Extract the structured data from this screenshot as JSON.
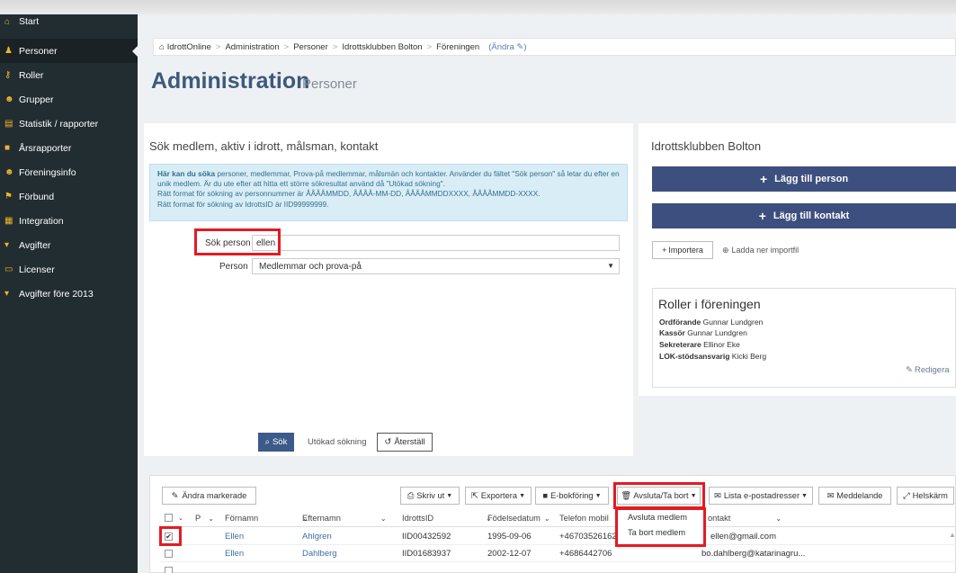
{
  "sidebar": {
    "items": [
      {
        "label": "Start",
        "icon": "home-icon",
        "glyph": "⌂"
      },
      {
        "label": "Personer",
        "icon": "person-icon",
        "glyph": "♟"
      },
      {
        "label": "Roller",
        "icon": "key-icon",
        "glyph": "⚷"
      },
      {
        "label": "Grupper",
        "icon": "group-icon",
        "glyph": "☻"
      },
      {
        "label": "Statistik / rapporter",
        "icon": "chart-icon",
        "glyph": "▤"
      },
      {
        "label": "Årsrapporter",
        "icon": "book-icon",
        "glyph": "■"
      },
      {
        "label": "Föreningsinfo",
        "icon": "group-icon",
        "glyph": "☻"
      },
      {
        "label": "Förbund",
        "icon": "flag-icon",
        "glyph": "⚑"
      },
      {
        "label": "Integration",
        "icon": "table-icon",
        "glyph": "▦"
      },
      {
        "label": "Avgifter",
        "icon": "cart-icon",
        "glyph": "▾"
      },
      {
        "label": "Licenser",
        "icon": "card-icon",
        "glyph": "▭"
      },
      {
        "label": "Avgifter före 2013",
        "icon": "cart-icon",
        "glyph": "▾"
      }
    ]
  },
  "breadcrumb": {
    "items": [
      "IdrottOnline",
      "Administration",
      "Personer",
      "Idrottsklubben Bolton",
      "Föreningen"
    ],
    "edit_label": "(Ändra ✎)"
  },
  "header": {
    "title": "Administration",
    "subtitle": "Personer"
  },
  "search": {
    "title": "Sök medlem, aktiv i idrott, målsman, kontakt",
    "info_bold": "Här kan du söka",
    "info_text": " personer, medlemmar, Prova-på medlemmar, målsmän och kontakter. Använder du fältet \"Sök person\" så letar du efter en unik medlem. Är du ute efter att hitta ett större sökresultat använd då \"Utökad sökning\".",
    "info_line2": "Rätt format för sökning av personnummer är ÅÅÅÅMMDD, ÅÅÅÅ-MM-DD, ÅÅÅÅMMDDXXXX, ÅÅÅÅMMDD-XXXX.",
    "info_line3": "Rätt format för sökning av IdrottsID är IID99999999.",
    "sok_label": "Sök person",
    "sok_value": "ellen",
    "person_label": "Person",
    "person_value": "Medlemmar och prova-på",
    "search_button": "Sök",
    "extended_link": "Utökad sökning",
    "reset_button": "Återställ"
  },
  "club": {
    "title": "Idrottsklubben Bolton",
    "add_person": "Lägg till person",
    "add_contact": "Lägg till kontakt",
    "import": "Importera",
    "download": "Ladda ner importfil",
    "roles_title": "Roller i föreningen",
    "roles": [
      {
        "role": "Ordförande",
        "name": "Gunnar Lundgren"
      },
      {
        "role": "Kassör",
        "name": "Gunnar Lundgren"
      },
      {
        "role": "Sekreterare",
        "name": "Ellinor Eke"
      },
      {
        "role": "LOK-stödsansvarig",
        "name": "Kicki Berg"
      }
    ],
    "edit": "Redigera"
  },
  "toolbar": {
    "edit_selected": "Ändra markerade",
    "print": "Skriv ut",
    "export": "Exportera",
    "ebook": "E-bokföring",
    "end_remove": "Avsluta/Ta bort",
    "email_list": "Lista e-postadresser",
    "message": "Meddelande",
    "fullscreen": "Helskärm"
  },
  "dropdown": {
    "items": [
      "Avsluta medlem",
      "Ta bort medlem"
    ]
  },
  "grid": {
    "headers": [
      "P",
      "Förnamn",
      "Efternamn",
      "IdrottsID",
      "Födelsedatum",
      "Telefon mobil",
      "ontakt"
    ],
    "rows": [
      {
        "checked": true,
        "first": "Ellen",
        "last": "Ahlgren",
        "id": "IID00432592",
        "birth": "1995-09-06",
        "phone": "+46703526162",
        "email": "ellen@gmail.com"
      },
      {
        "checked": false,
        "first": "Ellen",
        "last": "Dahlberg",
        "id": "IID01683937",
        "birth": "2002-12-07",
        "phone": "+4686442706",
        "email": "bo.dahlberg@katarinagru..."
      }
    ]
  },
  "colors": {
    "sidebar": "#222d32",
    "accent": "#3d4f7e",
    "highlight": "#e31b23",
    "info_bg": "#d9edf7"
  }
}
